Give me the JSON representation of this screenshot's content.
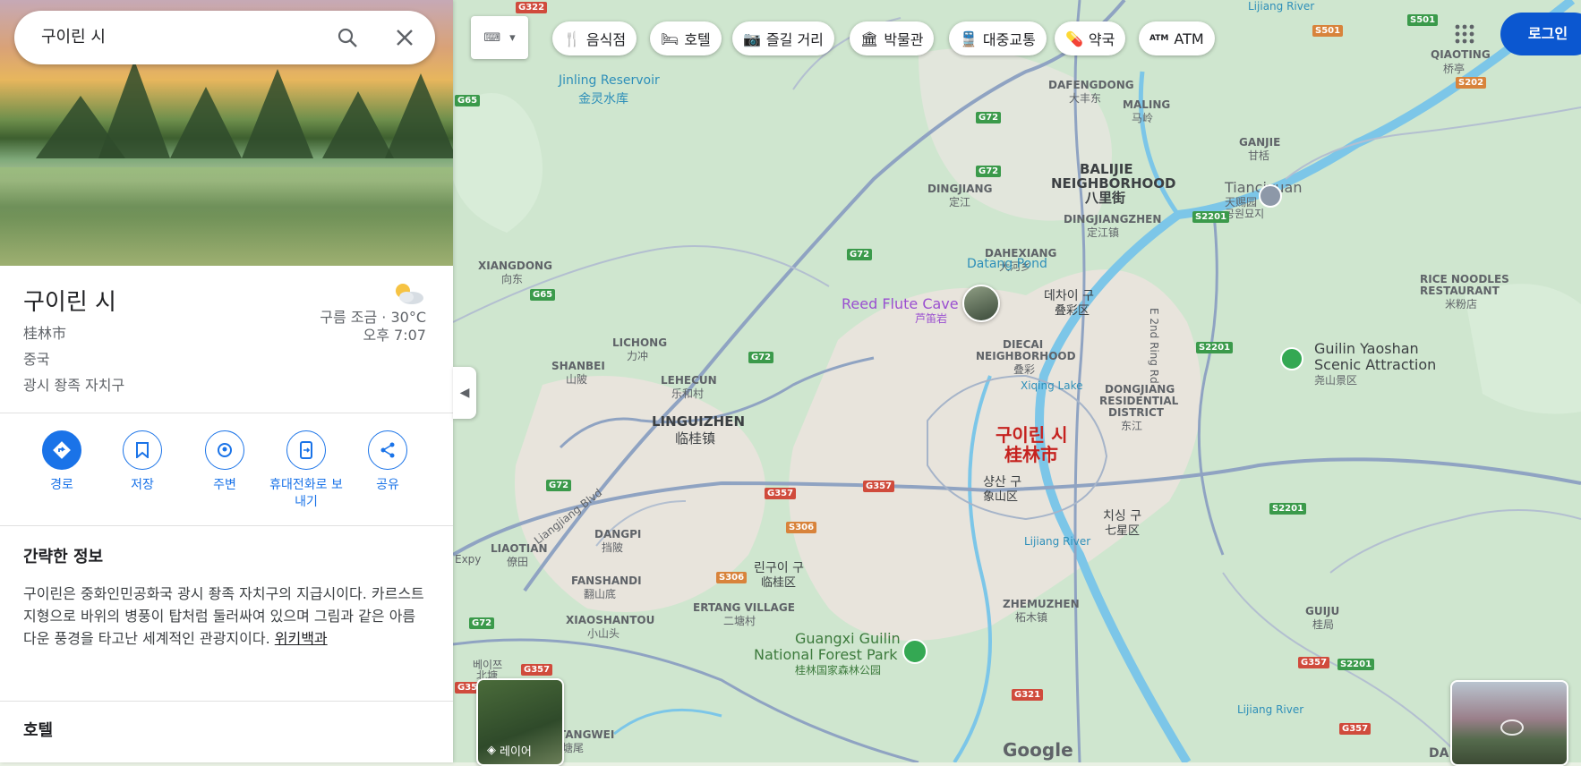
{
  "search": {
    "query": "구이린 시"
  },
  "place": {
    "title": "구이린 시",
    "local_name": "桂林市",
    "country": "중국",
    "region": "광시 좡족 자치구",
    "weather": "구름 조금 · 30°C",
    "time": "오후 7:07"
  },
  "actions": [
    {
      "label": "경로",
      "icon": "directions-icon"
    },
    {
      "label": "저장",
      "icon": "bookmark-icon"
    },
    {
      "label": "주변",
      "icon": "nearby-icon"
    },
    {
      "label": "휴대전화로 보내기",
      "icon": "phone-send-icon"
    },
    {
      "label": "공유",
      "icon": "share-icon"
    }
  ],
  "summary": {
    "heading": "간략한 정보",
    "text": "구이린은 중화인민공화국 광시 좡족 자치구의 지급시이다. 카르스트 지형으로 바위의 병풍이 탑처럼 둘러싸여 있으며 그림과 같은 아름다운 풍경을 타고난 세계적인 관광지이다.",
    "wiki_link": "위키백과"
  },
  "hotels": {
    "heading": "호텔"
  },
  "chips": [
    {
      "label": "음식점",
      "icon": "restaurant-icon"
    },
    {
      "label": "호텔",
      "icon": "hotel-icon"
    },
    {
      "label": "즐길 거리",
      "icon": "camera-icon"
    },
    {
      "label": "박물관",
      "icon": "museum-icon"
    },
    {
      "label": "대중교통",
      "icon": "transit-icon"
    },
    {
      "label": "약국",
      "icon": "pharmacy-icon"
    },
    {
      "label": "ATM",
      "icon": "atm-icon"
    }
  ],
  "login": "로그인",
  "layers_label": "레이어",
  "google_logo": "Google",
  "map_labels": {
    "reservoir_en": "Jinling Reservoir",
    "reservoir_zh": "金灵水库",
    "balijie_en": "BALIJIE",
    "balijie_en2": "NEIGHBORHOOD",
    "balijie_zh": "八里街",
    "dafengdong": "DAFENGDONG",
    "dafengdong_zh": "大丰东",
    "maling": "MALING",
    "maling_zh": "马岭",
    "ganjie": "GANJIE",
    "ganjie_zh": "甘栝",
    "qiaoting": "QIAOTING",
    "qiaoting_zh": "桥亭",
    "tianciyuan_en": "Tianciyuan",
    "tianciyuan_zh": "天赐园",
    "tianciyuan_ko": "공원묘지",
    "dingjiang": "DINGJIANG",
    "dingjiang_zh": "定江",
    "dingjiangzhen": "DINGJIANGZHEN",
    "dingjiangzhen_zh": "定江镇",
    "dahexiang": "DAHEXIANG",
    "dahexiang_zh": "大河乡",
    "xiangdong": "XIANGDONG",
    "xiangdong_zh": "向东",
    "datang_pond": "Datang Pond",
    "reed_en": "Reed Flute Cave",
    "reed_zh": "芦笛岩",
    "diecai_ko": "데차이 구",
    "diecai_zh": "叠彩区",
    "diecai_nb": "DIECAI",
    "diecai_nb2": "NEIGHBORHOOD",
    "diecai_nb_zh": "叠彩",
    "e2nd": "E 2nd Ring Rd",
    "rice_en": "RICE NOODLES",
    "rice_en2": "RESTAURANT",
    "rice_zh": "米粉店",
    "yaoshan_en": "Guilin Yaoshan",
    "yaoshan_en2": "Scenic Attraction",
    "yaoshan_zh": "尧山景区",
    "lichong": "LICHONG",
    "lichong_zh": "力冲",
    "shanbei": "SHANBEI",
    "shanbei_zh": "山陂",
    "lehecun": "LEHECUN",
    "lehecun_zh": "乐和村",
    "xiqing": "Xiqing Lake",
    "dongjiang": "DONGJIANG",
    "dongjiang2": "RESIDENTIAL",
    "dongjiang3": "DISTRICT",
    "dongjiang_zh": "东江",
    "linguizhen": "LINGUIZHEN",
    "linguizhen_zh": "临桂镇",
    "city_ko": "구이린 시",
    "city_zh": "桂林市",
    "xiangshan_ko": "샹산 구",
    "xiangshan_zh": "象山区",
    "qixing_ko": "치싱 구",
    "qixing_zh": "七星区",
    "liaotian": "LIAOTIAN",
    "liaotian_zh": "僚田",
    "dangpi": "DANGPI",
    "dangpi_zh": "挡陂",
    "lingui_ko": "린구이 구",
    "lingui_zh": "临桂区",
    "liangjiang": "Liangjiang Blvd",
    "fanshandi": "FANSHANDI",
    "fanshandi_zh": "翻山底",
    "lijiang1": "Lijiang River",
    "ertang": "ERTANG VILLAGE",
    "ertang_zh": "二塘村",
    "xiaoshantou": "XIAOSHANTOU",
    "xiaoshantou_zh": "小山头",
    "zhemuzhen": "ZHEMUZHEN",
    "zhemuzhen_zh": "柘木镇",
    "forest_en": "Guangxi Guilin",
    "forest_en2": "National Forest Park",
    "forest_zh": "桂林国家森林公园",
    "guiju": "GUIJU",
    "guiju_zh": "桂局",
    "lijiang2": "Lijiang River",
    "beiyi": "베이쯔",
    "beiyi_zh": "北塘",
    "tangwei": "TANGWEI",
    "tangwei_zh": "塘尾",
    "da": "DA",
    "expy": "Expy",
    "lijiang_top": "Lijiang River",
    "lijiang_mid": "Lijiang River"
  },
  "shields": {
    "g65a": "G65",
    "g65b": "G65",
    "g72a": "G72",
    "g72b": "G72",
    "g72c": "G72",
    "g72d": "G72",
    "g72e": "G72",
    "g72f": "G72",
    "s2201a": "S2201",
    "s2201b": "S2201",
    "s2201c": "S2201",
    "s2201d": "S2201",
    "s501a": "S501",
    "s501b": "S501",
    "s202": "S202",
    "s306a": "S306",
    "s306b": "S306",
    "g357a": "G357",
    "g357b": "G357",
    "g357c": "G357",
    "g357d": "G357",
    "g357e": "G357",
    "g357f": "G357",
    "g321": "G321",
    "g322": "G322"
  }
}
